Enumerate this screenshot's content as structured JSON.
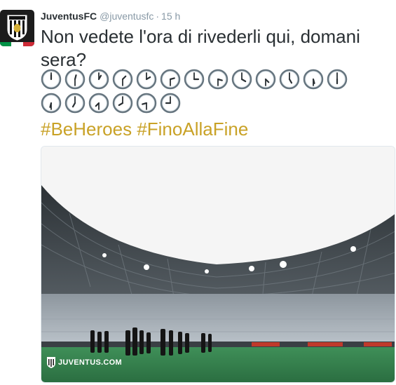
{
  "tweet": {
    "author_name": "JuventusFC",
    "author_handle": "@juventusfc",
    "separator": "·",
    "time": "15 h",
    "text": "Non vedete l'ora di rivederli qui, domani sera?",
    "hashtags": [
      "#BeHeroes",
      "#FinoAllaFine"
    ],
    "clock_emoji_rows": [
      [
        [
          "12:00"
        ],
        [
          "12:30"
        ],
        [
          "1:00"
        ],
        [
          "1:30"
        ],
        [
          "2:00"
        ],
        [
          "2:30"
        ],
        [
          "3:00"
        ],
        [
          "3:30"
        ],
        [
          "4:00"
        ],
        [
          "4:30"
        ],
        [
          "5:00"
        ],
        [
          "5:30"
        ],
        [
          "6:00"
        ]
      ],
      [
        [
          "6:30"
        ],
        [
          "7:00"
        ],
        [
          "7:30"
        ],
        [
          "8:00"
        ],
        [
          "8:30"
        ],
        [
          "9:00"
        ]
      ]
    ]
  },
  "media": {
    "watermark": "JUVENTUS.COM",
    "sky_color": "#f7f7f7",
    "pitch_color": "#2e7d4a"
  },
  "colors": {
    "hashtag": "#c9a227",
    "text": "#292f33",
    "meta": "#8899a6"
  }
}
